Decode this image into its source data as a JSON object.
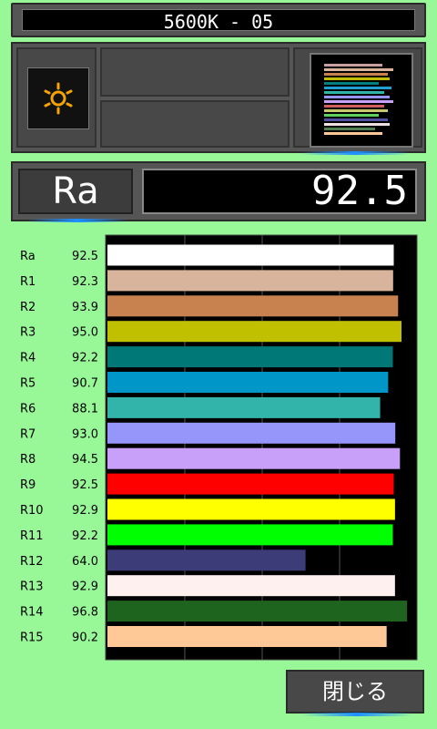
{
  "header": {
    "title": "5600K - 05"
  },
  "light_source": {
    "icon": "sun-icon",
    "icon_color": "#f5a300"
  },
  "ra_display": {
    "label": "Ra",
    "value": "92.5"
  },
  "close_button": {
    "label": "閉じる"
  },
  "chart_data": {
    "type": "bar",
    "orientation": "horizontal",
    "categories": [
      "Ra",
      "R1",
      "R2",
      "R3",
      "R4",
      "R5",
      "R6",
      "R7",
      "R8",
      "R9",
      "R10",
      "R11",
      "R12",
      "R13",
      "R14",
      "R15"
    ],
    "value_labels": [
      "92.5",
      "92.3",
      "93.9",
      "95.0",
      "92.2",
      "90.7",
      "88.1",
      "93.0",
      "94.5",
      "92.5",
      "92.9",
      "92.2",
      "64.0",
      "92.9",
      "96.8",
      "90.2"
    ],
    "values": [
      92.5,
      92.3,
      93.9,
      95.0,
      92.2,
      90.7,
      88.1,
      93.0,
      94.5,
      92.5,
      92.9,
      92.2,
      64.0,
      92.9,
      96.8,
      90.2
    ],
    "colors": [
      "#ffffff",
      "#d8b49c",
      "#c88250",
      "#c0c000",
      "#007878",
      "#0096c8",
      "#32b4aa",
      "#9696fa",
      "#c8a0fa",
      "#ff0000",
      "#ffff00",
      "#00ff00",
      "#3c3c78",
      "#fff0f0",
      "#1e641e",
      "#ffc896"
    ],
    "xlim": [
      0,
      100
    ],
    "grid": true,
    "background": "#000000"
  }
}
